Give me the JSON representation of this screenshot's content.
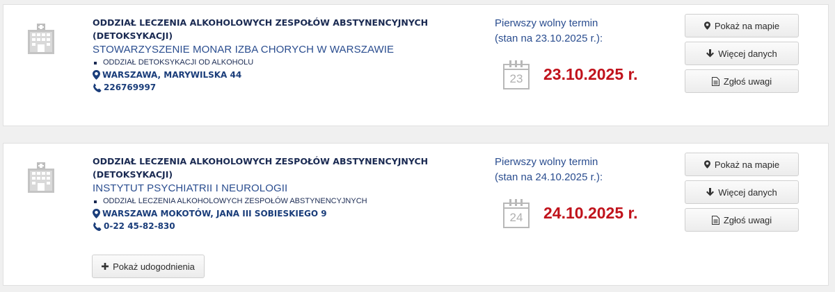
{
  "results": [
    {
      "unit_name": "ODDZIAŁ LECZENIA ALKOHOLOWYCH ZESPOŁÓW ABSTYNENCYJNYCH (DETOKSYKACJI)",
      "provider": "STOWARZYSZENIE MONAR IZBA CHORYCH W WARSZAWIE",
      "sub_unit": "ODDZIAŁ DETOKSYKACJI OD ALKOHOLU",
      "address": "WARSZAWA, MARYWILSKA 44",
      "phone": "226769997",
      "term_label_1": "Pierwszy wolny termin",
      "term_label_2": "(stan na 23.10.2025 r.):",
      "calendar_day": "23",
      "first_date": "23.10.2025 r.",
      "buttons": {
        "map": "Pokaż na mapie",
        "more": "Więcej danych",
        "report": "Zgłoś uwagi"
      }
    },
    {
      "unit_name": "ODDZIAŁ LECZENIA ALKOHOLOWYCH ZESPOŁÓW ABSTYNENCYJNYCH (DETOKSYKACJI)",
      "provider": "INSTYTUT PSYCHIATRII I NEUROLOGII",
      "sub_unit": "ODDZIAŁ LECZENIA ALKOHOLOWYCH ZESPOŁÓW ABSTYNENCYJNYCH",
      "address": "WARSZAWA MOKOTÓW, JANA III SOBIESKIEGO 9",
      "phone": "0-22 45-82-830",
      "term_label_1": "Pierwszy wolny termin",
      "term_label_2": "(stan na 24.10.2025 r.):",
      "calendar_day": "24",
      "first_date": "24.10.2025 r.",
      "buttons": {
        "map": "Pokaż na mapie",
        "more": "Więcej danych",
        "report": "Zgłoś uwagi"
      },
      "amenities_button": "Pokaż udogodnienia"
    }
  ],
  "colors": {
    "accent_red": "#c0121b",
    "navy": "#1a2a52",
    "link_blue": "#2a4d8f"
  },
  "icons": [
    "hospital-icon",
    "map-marker-icon",
    "phone-icon",
    "calendar-icon",
    "arrow-down-icon",
    "document-icon",
    "plus-icon"
  ]
}
